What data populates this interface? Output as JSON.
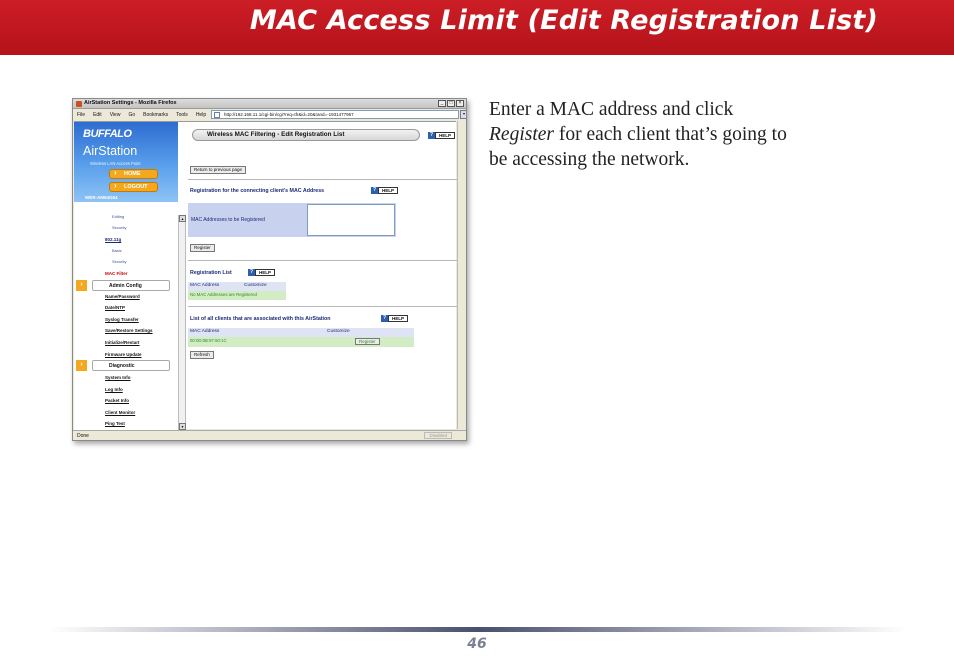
{
  "page": {
    "title": "MAC Access Limit (Edit Registration List)",
    "description_lines": [
      {
        "before": "Enter a MAC address and click",
        "italic": "",
        "after": ""
      },
      {
        "before": "",
        "italic": "Register",
        "after": " for each client that’s going to"
      },
      {
        "before": "be accessing the network.",
        "italic": "",
        "after": ""
      }
    ],
    "page_number": "46"
  },
  "screenshot": {
    "window_title": "AirStation Settings - Mozilla Firefox",
    "menu": [
      "File",
      "Edit",
      "View",
      "Go",
      "Bookmarks",
      "Tools",
      "Help"
    ],
    "url": "http://192.168.11.1/cgi-bin/cgi?req=tfr&id=20&rand=-1931477967",
    "status": "Done",
    "status_right": "Disabled",
    "sidebar": {
      "brand": "BUFFALO",
      "product": "AirStation",
      "tagline": "Wireless LAN Access Point",
      "home_label": "HOME",
      "logout_label": "LOGOUT",
      "model": "WER-AM54G54",
      "items": {
        "editing": "Editing",
        "security": "Security",
        "mode_11g": "802.11g",
        "basic": "Basic",
        "security2": "Security",
        "mac_filter": "MAC Filter",
        "admin_config": "Admin Config",
        "name_password": "Name/Password",
        "date_ntp": "Date/NTP",
        "syslog": "Syslog Transfer",
        "save_restore": "Save/Restore Settings",
        "initialize": "Initialize/Restart",
        "firmware": "Firmware Update",
        "diagnostic": "Diagnostic",
        "system_info": "System Info",
        "log_info": "Log Info",
        "packet_info": "Packet Info",
        "client_monitor": "Client Monitor",
        "ping_test": "Ping Test"
      }
    },
    "main": {
      "panel_title": "Wireless MAC Filtering - Edit Registration List",
      "help_label": "HELP",
      "return_button": "Return to previous page",
      "reg_section_title": "Registration for the connecting client's MAC Address",
      "mac_label": "MAC Addresses to be Registered",
      "register_button": "Register",
      "reg_list_title": "Registration List",
      "col_mac": "MAC Address",
      "col_customize": "Customize",
      "no_entries": "No MAC Addresses are Registered",
      "assoc_title": "List of all clients that are associated with this AirStation",
      "assoc_mac": "00:0D:0B:97:60:1C",
      "assoc_register": "Register",
      "refresh_button": "Refresh"
    }
  }
}
